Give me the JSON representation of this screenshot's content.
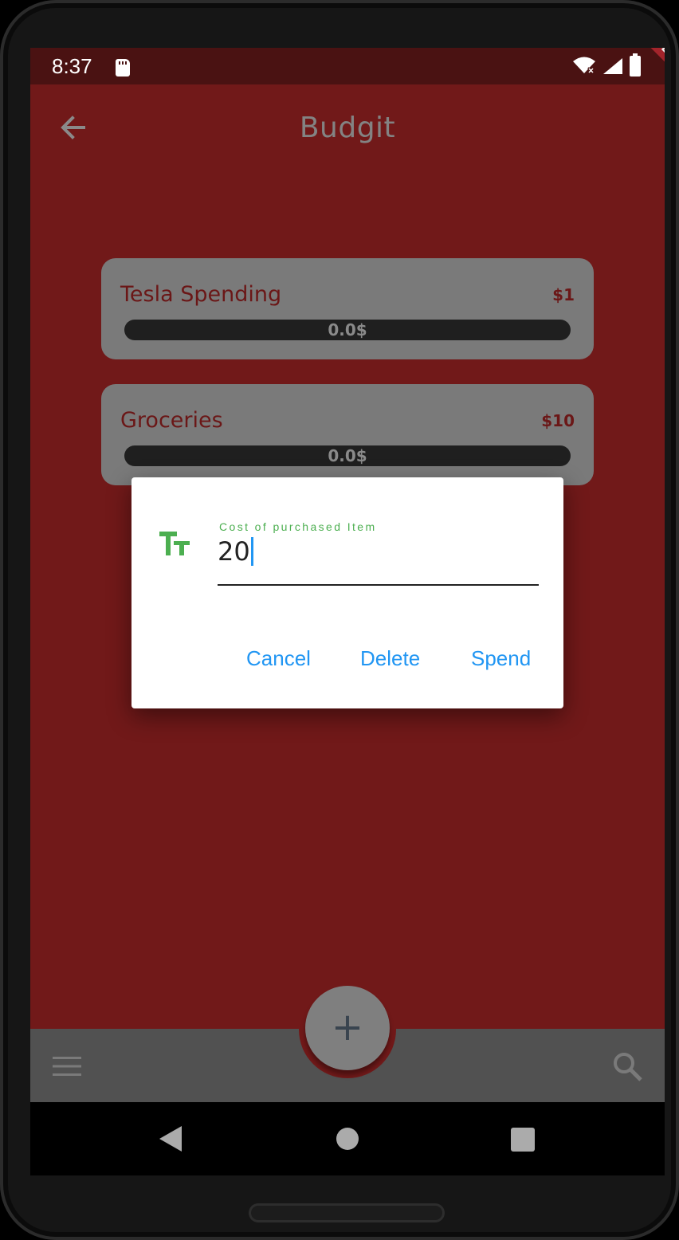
{
  "status_bar": {
    "time": "8:37"
  },
  "app_bar": {
    "title": "Budgit"
  },
  "debug_banner": "DEBUG",
  "budgets": [
    {
      "name": "Tesla Spending",
      "amount": "$1",
      "spent_label": "0.0$",
      "spent_fraction": 0
    },
    {
      "name": "Groceries",
      "amount": "$10",
      "spent_label": "0.0$",
      "spent_fraction": 0
    }
  ],
  "fab": {
    "label": "+"
  },
  "dialog": {
    "field_label": "Cost of purchased Item",
    "field_value": "20",
    "buttons": {
      "cancel": "Cancel",
      "delete": "Delete",
      "spend": "Spend"
    }
  },
  "icons": {
    "back": "arrow-back-icon",
    "menu": "menu-icon",
    "search": "search-icon",
    "field": "text-fields-icon",
    "wifi": "wifi-off-icon",
    "battery": "battery-icon",
    "sd": "sd-card-icon"
  },
  "colors": {
    "primary": "#711919",
    "card": "#7a7a7a",
    "bottom_bar": "#515151",
    "accent_blue": "#2196f3",
    "label_green": "#4caf50"
  }
}
